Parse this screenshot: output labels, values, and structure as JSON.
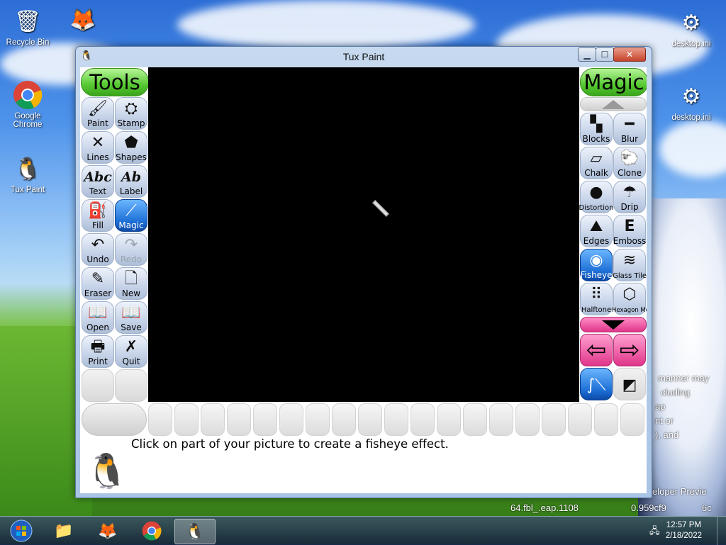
{
  "desktop": {
    "icons": [
      {
        "label": "Recycle Bin",
        "icon": "recycle-bin-icon"
      },
      {
        "label": "",
        "icon": "firefox-icon"
      },
      {
        "label": "Google Chrome",
        "icon": "chrome-icon"
      },
      {
        "label": "Tux Paint",
        "icon": "tux-icon"
      },
      {
        "label": "desktop.ini",
        "icon": "settings-file-icon"
      },
      {
        "label": "desktop.ini",
        "icon": "settings-file-icon"
      }
    ],
    "background_text": [
      "manner may",
      "cluding",
      "ap",
      "nt or",
      "), and",
      "eloper Previe",
      "64.fbl_.eap.1108",
      "0.959cf9",
      "6c"
    ]
  },
  "window": {
    "title": "Tux Paint",
    "controls": {
      "minimize": "▁",
      "maximize": "☐",
      "close": "✕"
    }
  },
  "tools": {
    "header": "Tools",
    "items": [
      {
        "label": "Paint",
        "icon": "paintbrush-icon"
      },
      {
        "label": "Stamp",
        "icon": "stamp-icon"
      },
      {
        "label": "Lines",
        "icon": "lines-icon"
      },
      {
        "label": "Shapes",
        "icon": "pentagon-icon"
      },
      {
        "label": "Text",
        "icon": "text-abc-icon",
        "glyph": "Abc"
      },
      {
        "label": "Label",
        "icon": "label-ab-icon",
        "glyph": "Ab"
      },
      {
        "label": "Fill",
        "icon": "paint-bucket-icon"
      },
      {
        "label": "Magic",
        "icon": "magic-wand-icon",
        "selected": true
      },
      {
        "label": "Undo",
        "icon": "undo-icon"
      },
      {
        "label": "Redo",
        "icon": "redo-icon",
        "disabled": true
      },
      {
        "label": "Eraser",
        "icon": "eraser-icon"
      },
      {
        "label": "New",
        "icon": "new-page-icon"
      },
      {
        "label": "Open",
        "icon": "open-book-icon"
      },
      {
        "label": "Save",
        "icon": "save-book-icon"
      },
      {
        "label": "Print",
        "icon": "printer-icon"
      },
      {
        "label": "Quit",
        "icon": "quit-x-icon"
      }
    ]
  },
  "magic": {
    "header": "Magic",
    "items": [
      {
        "label": "Blocks",
        "icon": "blocks-icon"
      },
      {
        "label": "Blur",
        "icon": "blur-icon"
      },
      {
        "label": "Chalk",
        "icon": "chalk-icon"
      },
      {
        "label": "Clone",
        "icon": "clone-sheep-icon"
      },
      {
        "label": "Distortion",
        "icon": "distortion-icon"
      },
      {
        "label": "Drip",
        "icon": "drip-icon"
      },
      {
        "label": "Edges",
        "icon": "edges-icon"
      },
      {
        "label": "Emboss",
        "icon": "emboss-icon"
      },
      {
        "label": "Fisheye",
        "icon": "fisheye-icon",
        "selected": true
      },
      {
        "label": "Glass Tile",
        "icon": "glass-tile-icon"
      },
      {
        "label": "Halftone",
        "icon": "halftone-icon"
      },
      {
        "label": "Hexagon Mosaic",
        "icon": "hexagon-mosaic-icon"
      }
    ]
  },
  "status": {
    "message": "Click on part of your picture to create a fisheye effect."
  },
  "taskbar": {
    "items": [
      "start-orb-icon",
      "file-explorer-icon",
      "firefox-icon",
      "chrome-icon",
      "tux-paint-icon"
    ],
    "time": "12:57 PM",
    "date": "2/18/2022"
  }
}
